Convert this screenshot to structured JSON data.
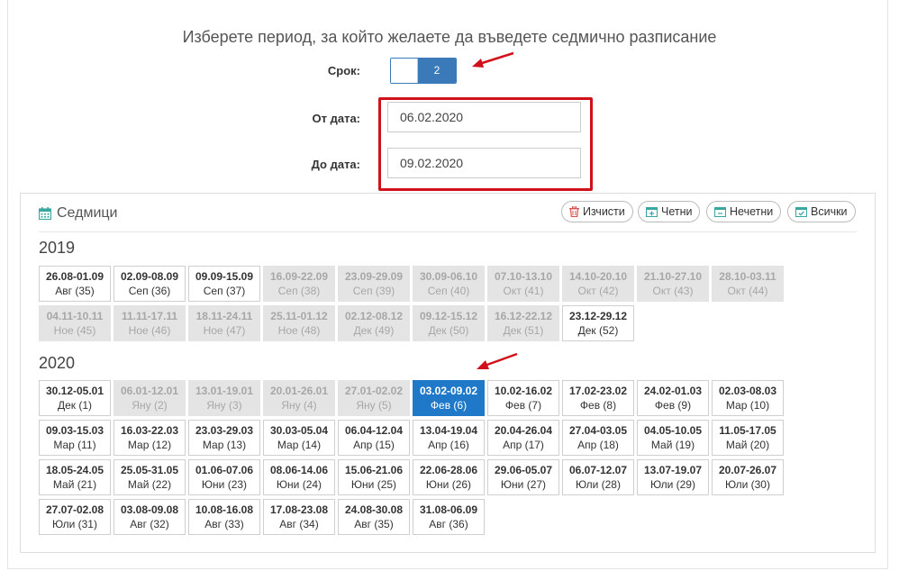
{
  "header": {
    "title": "Изберете период, за който желаете да въведете седмично разписание"
  },
  "form": {
    "term_label": "Срок:",
    "term_value": "2",
    "from_label": "От дата:",
    "from_value": "06.02.2020",
    "to_label": "До дата:",
    "to_value": "09.02.2020"
  },
  "colors": {
    "accent": "#3a7ab8",
    "selected": "#1f78c8",
    "annotation": "#d0101a"
  },
  "weeks_panel": {
    "title": "Седмици",
    "buttons": {
      "clear": "Изчисти",
      "even": "Четни",
      "odd": "Нечетни",
      "all": "Всички"
    },
    "years": [
      {
        "year": "2019",
        "weeks": [
          {
            "range": "26.08-01.09",
            "label": "Авг (35)",
            "state": "enabled"
          },
          {
            "range": "02.09-08.09",
            "label": "Сеп (36)",
            "state": "enabled"
          },
          {
            "range": "09.09-15.09",
            "label": "Сеп (37)",
            "state": "enabled"
          },
          {
            "range": "16.09-22.09",
            "label": "Сеп (38)",
            "state": "disabled"
          },
          {
            "range": "23.09-29.09",
            "label": "Сеп (39)",
            "state": "disabled"
          },
          {
            "range": "30.09-06.10",
            "label": "Сеп (40)",
            "state": "disabled"
          },
          {
            "range": "07.10-13.10",
            "label": "Окт (41)",
            "state": "disabled"
          },
          {
            "range": "14.10-20.10",
            "label": "Окт (42)",
            "state": "disabled"
          },
          {
            "range": "21.10-27.10",
            "label": "Окт (43)",
            "state": "disabled"
          },
          {
            "range": "28.10-03.11",
            "label": "Окт (44)",
            "state": "disabled"
          },
          {
            "range": "04.11-10.11",
            "label": "Ное (45)",
            "state": "disabled"
          },
          {
            "range": "11.11-17.11",
            "label": "Ное (46)",
            "state": "disabled"
          },
          {
            "range": "18.11-24.11",
            "label": "Ное (47)",
            "state": "disabled"
          },
          {
            "range": "25.11-01.12",
            "label": "Ное (48)",
            "state": "disabled"
          },
          {
            "range": "02.12-08.12",
            "label": "Дек (49)",
            "state": "disabled"
          },
          {
            "range": "09.12-15.12",
            "label": "Дек (50)",
            "state": "disabled"
          },
          {
            "range": "16.12-22.12",
            "label": "Дек (51)",
            "state": "disabled"
          },
          {
            "range": "23.12-29.12",
            "label": "Дек (52)",
            "state": "enabled"
          }
        ]
      },
      {
        "year": "2020",
        "weeks": [
          {
            "range": "30.12-05.01",
            "label": "Дек (1)",
            "state": "enabled"
          },
          {
            "range": "06.01-12.01",
            "label": "Яну (2)",
            "state": "disabled"
          },
          {
            "range": "13.01-19.01",
            "label": "Яну (3)",
            "state": "disabled"
          },
          {
            "range": "20.01-26.01",
            "label": "Яну (4)",
            "state": "disabled"
          },
          {
            "range": "27.01-02.02",
            "label": "Яну (5)",
            "state": "disabled"
          },
          {
            "range": "03.02-09.02",
            "label": "Фев (6)",
            "state": "selected"
          },
          {
            "range": "10.02-16.02",
            "label": "Фев (7)",
            "state": "enabled"
          },
          {
            "range": "17.02-23.02",
            "label": "Фев (8)",
            "state": "enabled"
          },
          {
            "range": "24.02-01.03",
            "label": "Фев (9)",
            "state": "enabled"
          },
          {
            "range": "02.03-08.03",
            "label": "Мар (10)",
            "state": "enabled"
          },
          {
            "range": "09.03-15.03",
            "label": "Мар (11)",
            "state": "enabled"
          },
          {
            "range": "16.03-22.03",
            "label": "Мар (12)",
            "state": "enabled"
          },
          {
            "range": "23.03-29.03",
            "label": "Мар (13)",
            "state": "enabled"
          },
          {
            "range": "30.03-05.04",
            "label": "Мар (14)",
            "state": "enabled"
          },
          {
            "range": "06.04-12.04",
            "label": "Апр (15)",
            "state": "enabled"
          },
          {
            "range": "13.04-19.04",
            "label": "Апр (16)",
            "state": "enabled"
          },
          {
            "range": "20.04-26.04",
            "label": "Апр (17)",
            "state": "enabled"
          },
          {
            "range": "27.04-03.05",
            "label": "Апр (18)",
            "state": "enabled"
          },
          {
            "range": "04.05-10.05",
            "label": "Май (19)",
            "state": "enabled"
          },
          {
            "range": "11.05-17.05",
            "label": "Май (20)",
            "state": "enabled"
          },
          {
            "range": "18.05-24.05",
            "label": "Май (21)",
            "state": "enabled"
          },
          {
            "range": "25.05-31.05",
            "label": "Май (22)",
            "state": "enabled"
          },
          {
            "range": "01.06-07.06",
            "label": "Юни (23)",
            "state": "enabled"
          },
          {
            "range": "08.06-14.06",
            "label": "Юни (24)",
            "state": "enabled"
          },
          {
            "range": "15.06-21.06",
            "label": "Юни (25)",
            "state": "enabled"
          },
          {
            "range": "22.06-28.06",
            "label": "Юни (26)",
            "state": "enabled"
          },
          {
            "range": "29.06-05.07",
            "label": "Юни (27)",
            "state": "enabled"
          },
          {
            "range": "06.07-12.07",
            "label": "Юли (28)",
            "state": "enabled"
          },
          {
            "range": "13.07-19.07",
            "label": "Юли (29)",
            "state": "enabled"
          },
          {
            "range": "20.07-26.07",
            "label": "Юли (30)",
            "state": "enabled"
          },
          {
            "range": "27.07-02.08",
            "label": "Юли (31)",
            "state": "enabled"
          },
          {
            "range": "03.08-09.08",
            "label": "Авг (32)",
            "state": "enabled"
          },
          {
            "range": "10.08-16.08",
            "label": "Авг (33)",
            "state": "enabled"
          },
          {
            "range": "17.08-23.08",
            "label": "Авг (34)",
            "state": "enabled"
          },
          {
            "range": "24.08-30.08",
            "label": "Авг (35)",
            "state": "enabled"
          },
          {
            "range": "31.08-06.09",
            "label": "Авг (36)",
            "state": "enabled"
          }
        ]
      }
    ]
  }
}
